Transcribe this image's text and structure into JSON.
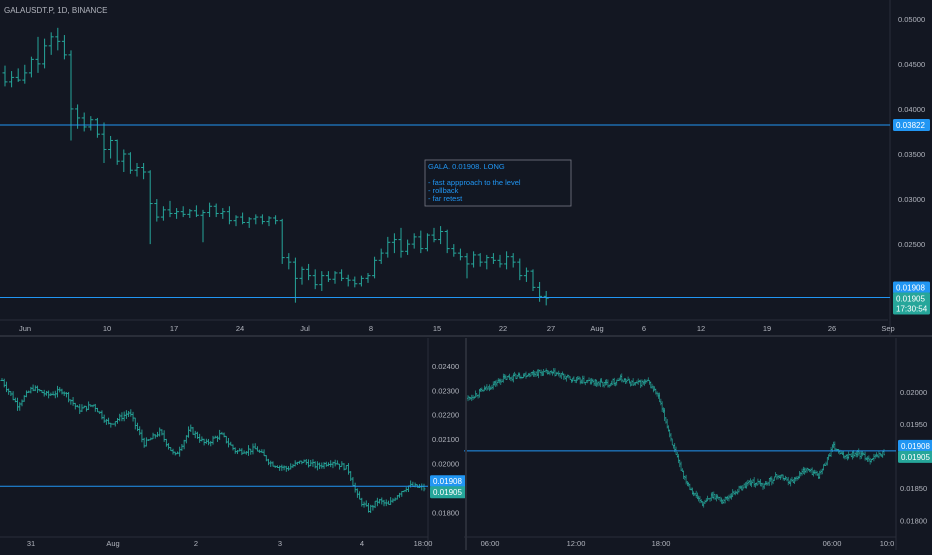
{
  "colors": {
    "background": "#131722",
    "candle": "#26a69a",
    "level_line": "#2196f3",
    "label_text": "#b2b5be",
    "divider": "#2a2e39",
    "price_tag_level": "#2196f3",
    "price_tag_last": "#26a69a",
    "annotation_text": "#2196f3",
    "annotation_border": "#787b86"
  },
  "header": {
    "symbol_line": "GALAUSDT.P, 1D, BINANCE"
  },
  "annotation": {
    "lines": [
      "GALA. 0.01908. LONG",
      "",
      "- fast appproach to the level",
      "- rollback",
      "- far retest"
    ]
  },
  "chart_data": [
    {
      "type": "bar",
      "panel": "main",
      "interval": "1D",
      "x_tick_labels": [
        "Jun",
        "10",
        "17",
        "24",
        "Jul",
        "8",
        "15",
        "22",
        "27",
        "Aug",
        "6",
        "12",
        "19",
        "26",
        "Sep"
      ],
      "y_tick_labels": [
        "0.05000",
        "0.04500",
        "0.04000",
        "0.03500",
        "0.03000",
        "0.02500"
      ],
      "ylim": [
        0.0168,
        0.0512
      ],
      "horizontal_levels": [
        0.03822,
        0.01908
      ],
      "price_tags": [
        {
          "value": "0.03822",
          "kind": "level"
        },
        {
          "value": "0.01908",
          "kind": "level"
        },
        {
          "value": "0.01905",
          "kind": "last"
        },
        {
          "value": "17:30:54",
          "kind": "countdown"
        }
      ],
      "series": [
        {
          "values": [
            {
              "o": 0.044,
              "h": 0.0448,
              "l": 0.0425,
              "c": 0.043
            },
            {
              "o": 0.043,
              "h": 0.0442,
              "l": 0.0424,
              "c": 0.0435
            },
            {
              "o": 0.0435,
              "h": 0.0445,
              "l": 0.043,
              "c": 0.0432
            },
            {
              "o": 0.0432,
              "h": 0.0449,
              "l": 0.0428,
              "c": 0.044
            },
            {
              "o": 0.044,
              "h": 0.0458,
              "l": 0.0435,
              "c": 0.0455
            },
            {
              "o": 0.0455,
              "h": 0.048,
              "l": 0.044,
              "c": 0.045
            },
            {
              "o": 0.045,
              "h": 0.0478,
              "l": 0.0445,
              "c": 0.047
            },
            {
              "o": 0.047,
              "h": 0.0485,
              "l": 0.046,
              "c": 0.048
            },
            {
              "o": 0.048,
              "h": 0.049,
              "l": 0.0465,
              "c": 0.0475
            },
            {
              "o": 0.0475,
              "h": 0.0482,
              "l": 0.0455,
              "c": 0.046
            },
            {
              "o": 0.046,
              "h": 0.0465,
              "l": 0.0365,
              "c": 0.04
            },
            {
              "o": 0.04,
              "h": 0.0405,
              "l": 0.0378,
              "c": 0.039
            },
            {
              "o": 0.039,
              "h": 0.0396,
              "l": 0.0375,
              "c": 0.038
            },
            {
              "o": 0.038,
              "h": 0.0392,
              "l": 0.0376,
              "c": 0.0388
            },
            {
              "o": 0.0388,
              "h": 0.039,
              "l": 0.0368,
              "c": 0.0372
            },
            {
              "o": 0.0372,
              "h": 0.0385,
              "l": 0.034,
              "c": 0.0355
            },
            {
              "o": 0.0355,
              "h": 0.037,
              "l": 0.0345,
              "c": 0.0365
            },
            {
              "o": 0.0365,
              "h": 0.0366,
              "l": 0.0338,
              "c": 0.0342
            },
            {
              "o": 0.0342,
              "h": 0.0355,
              "l": 0.033,
              "c": 0.035
            },
            {
              "o": 0.035,
              "h": 0.0352,
              "l": 0.0328,
              "c": 0.0332
            },
            {
              "o": 0.0332,
              "h": 0.034,
              "l": 0.0325,
              "c": 0.0335
            },
            {
              "o": 0.0335,
              "h": 0.034,
              "l": 0.0322,
              "c": 0.033
            },
            {
              "o": 0.033,
              "h": 0.0332,
              "l": 0.025,
              "c": 0.0295
            },
            {
              "o": 0.0295,
              "h": 0.03,
              "l": 0.0275,
              "c": 0.028
            },
            {
              "o": 0.028,
              "h": 0.0292,
              "l": 0.0276,
              "c": 0.0288
            },
            {
              "o": 0.0288,
              "h": 0.0298,
              "l": 0.028,
              "c": 0.0284
            },
            {
              "o": 0.0284,
              "h": 0.029,
              "l": 0.0278,
              "c": 0.0286
            },
            {
              "o": 0.0286,
              "h": 0.0292,
              "l": 0.028,
              "c": 0.0283
            },
            {
              "o": 0.0283,
              "h": 0.0289,
              "l": 0.0279,
              "c": 0.0287
            },
            {
              "o": 0.0287,
              "h": 0.0293,
              "l": 0.028,
              "c": 0.0282
            },
            {
              "o": 0.0282,
              "h": 0.0288,
              "l": 0.0252,
              "c": 0.0285
            },
            {
              "o": 0.0285,
              "h": 0.0296,
              "l": 0.028,
              "c": 0.0292
            },
            {
              "o": 0.0292,
              "h": 0.0295,
              "l": 0.028,
              "c": 0.0284
            },
            {
              "o": 0.0284,
              "h": 0.029,
              "l": 0.0278,
              "c": 0.0286
            },
            {
              "o": 0.0286,
              "h": 0.0292,
              "l": 0.0272,
              "c": 0.0276
            },
            {
              "o": 0.0276,
              "h": 0.0282,
              "l": 0.027,
              "c": 0.028
            },
            {
              "o": 0.028,
              "h": 0.0285,
              "l": 0.0272,
              "c": 0.0274
            },
            {
              "o": 0.0274,
              "h": 0.028,
              "l": 0.0268,
              "c": 0.0278
            },
            {
              "o": 0.0278,
              "h": 0.0283,
              "l": 0.0272,
              "c": 0.028
            },
            {
              "o": 0.028,
              "h": 0.0283,
              "l": 0.0272,
              "c": 0.0275
            },
            {
              "o": 0.0275,
              "h": 0.0281,
              "l": 0.027,
              "c": 0.0279
            },
            {
              "o": 0.0279,
              "h": 0.0282,
              "l": 0.0272,
              "c": 0.0276
            },
            {
              "o": 0.0276,
              "h": 0.0278,
              "l": 0.0228,
              "c": 0.0235
            },
            {
              "o": 0.0235,
              "h": 0.024,
              "l": 0.0222,
              "c": 0.023
            },
            {
              "o": 0.023,
              "h": 0.0235,
              "l": 0.0185,
              "c": 0.0212
            },
            {
              "o": 0.0212,
              "h": 0.0225,
              "l": 0.0205,
              "c": 0.0222
            },
            {
              "o": 0.0222,
              "h": 0.0228,
              "l": 0.021,
              "c": 0.0215
            },
            {
              "o": 0.0215,
              "h": 0.0222,
              "l": 0.02,
              "c": 0.0205
            },
            {
              "o": 0.0205,
              "h": 0.022,
              "l": 0.0198,
              "c": 0.0215
            },
            {
              "o": 0.0215,
              "h": 0.022,
              "l": 0.0208,
              "c": 0.0211
            },
            {
              "o": 0.0211,
              "h": 0.022,
              "l": 0.0206,
              "c": 0.0218
            },
            {
              "o": 0.0218,
              "h": 0.0222,
              "l": 0.0209,
              "c": 0.0212
            },
            {
              "o": 0.0212,
              "h": 0.0216,
              "l": 0.0203,
              "c": 0.021
            },
            {
              "o": 0.021,
              "h": 0.0214,
              "l": 0.0202,
              "c": 0.0206
            },
            {
              "o": 0.0206,
              "h": 0.0215,
              "l": 0.0203,
              "c": 0.0212
            },
            {
              "o": 0.0212,
              "h": 0.0218,
              "l": 0.0207,
              "c": 0.0215
            },
            {
              "o": 0.0215,
              "h": 0.0236,
              "l": 0.0212,
              "c": 0.0232
            },
            {
              "o": 0.0232,
              "h": 0.0245,
              "l": 0.0228,
              "c": 0.024
            },
            {
              "o": 0.024,
              "h": 0.0258,
              "l": 0.0235,
              "c": 0.0252
            },
            {
              "o": 0.0252,
              "h": 0.0262,
              "l": 0.024,
              "c": 0.0255
            },
            {
              "o": 0.0255,
              "h": 0.0268,
              "l": 0.0235,
              "c": 0.0242
            },
            {
              "o": 0.0242,
              "h": 0.0255,
              "l": 0.0238,
              "c": 0.025
            },
            {
              "o": 0.025,
              "h": 0.0262,
              "l": 0.0245,
              "c": 0.0258
            },
            {
              "o": 0.0258,
              "h": 0.0265,
              "l": 0.024,
              "c": 0.0245
            },
            {
              "o": 0.0245,
              "h": 0.0262,
              "l": 0.0242,
              "c": 0.026
            },
            {
              "o": 0.026,
              "h": 0.0268,
              "l": 0.0252,
              "c": 0.0255
            },
            {
              "o": 0.0255,
              "h": 0.027,
              "l": 0.025,
              "c": 0.0264
            },
            {
              "o": 0.0264,
              "h": 0.0266,
              "l": 0.024,
              "c": 0.0245
            },
            {
              "o": 0.0245,
              "h": 0.025,
              "l": 0.0236,
              "c": 0.024
            },
            {
              "o": 0.024,
              "h": 0.0245,
              "l": 0.0232,
              "c": 0.0236
            },
            {
              "o": 0.0236,
              "h": 0.024,
              "l": 0.0212,
              "c": 0.0228
            },
            {
              "o": 0.0228,
              "h": 0.0242,
              "l": 0.0224,
              "c": 0.0238
            },
            {
              "o": 0.0238,
              "h": 0.024,
              "l": 0.0225,
              "c": 0.023
            },
            {
              "o": 0.023,
              "h": 0.0238,
              "l": 0.0222,
              "c": 0.0235
            },
            {
              "o": 0.0235,
              "h": 0.024,
              "l": 0.0228,
              "c": 0.0232
            },
            {
              "o": 0.0232,
              "h": 0.0238,
              "l": 0.0224,
              "c": 0.0228
            },
            {
              "o": 0.0228,
              "h": 0.0242,
              "l": 0.0222,
              "c": 0.0236
            },
            {
              "o": 0.0236,
              "h": 0.024,
              "l": 0.0224,
              "c": 0.023
            },
            {
              "o": 0.023,
              "h": 0.0234,
              "l": 0.021,
              "c": 0.0215
            },
            {
              "o": 0.0215,
              "h": 0.0224,
              "l": 0.0208,
              "c": 0.022
            },
            {
              "o": 0.022,
              "h": 0.0222,
              "l": 0.0198,
              "c": 0.0202
            },
            {
              "o": 0.0202,
              "h": 0.0208,
              "l": 0.0186,
              "c": 0.0192
            },
            {
              "o": 0.0192,
              "h": 0.0198,
              "l": 0.0182,
              "c": 0.019
            }
          ]
        }
      ]
    },
    {
      "type": "bar",
      "panel": "bottom-left",
      "x_tick_labels": [
        "31",
        "Aug",
        "2",
        "3",
        "4",
        "18:00"
      ],
      "y_tick_labels": [
        "0.02400",
        "0.02300",
        "0.02200",
        "0.02100",
        "0.02000",
        "0.01800"
      ],
      "ylim": [
        0.0177,
        0.0244
      ],
      "horizontal_levels": [
        0.01908
      ],
      "price_tags": [
        {
          "value": "0.01908",
          "kind": "level"
        },
        {
          "value": "0.01905",
          "kind": "last"
        }
      ],
      "path": [
        [
          0,
          0.0234
        ],
        [
          6,
          0.0224
        ],
        [
          12,
          0.0231
        ],
        [
          18,
          0.0228
        ],
        [
          24,
          0.023
        ],
        [
          30,
          0.0222
        ],
        [
          36,
          0.0224
        ],
        [
          42,
          0.0216
        ],
        [
          50,
          0.0221
        ],
        [
          56,
          0.0208
        ],
        [
          62,
          0.0213
        ],
        [
          68,
          0.0203
        ],
        [
          74,
          0.0214
        ],
        [
          80,
          0.0208
        ],
        [
          86,
          0.0212
        ],
        [
          92,
          0.0205
        ],
        [
          100,
          0.0206
        ],
        [
          106,
          0.02
        ],
        [
          112,
          0.0198
        ],
        [
          118,
          0.0201
        ],
        [
          124,
          0.0199
        ],
        [
          130,
          0.0201
        ],
        [
          136,
          0.0198
        ],
        [
          140,
          0.0186
        ],
        [
          144,
          0.0181
        ],
        [
          148,
          0.0185
        ],
        [
          152,
          0.0183
        ],
        [
          156,
          0.0188
        ],
        [
          160,
          0.0191
        ],
        [
          166,
          0.019
        ]
      ],
      "x_range": [
        0,
        166
      ]
    },
    {
      "type": "bar",
      "panel": "bottom-right",
      "x_tick_labels": [
        "06:00",
        "12:00",
        "18:00",
        "06:00",
        "10:0"
      ],
      "y_tick_labels": [
        "0.02000",
        "0.01950",
        "0.01850",
        "0.01800"
      ],
      "ylim": [
        0.01785,
        0.02065
      ],
      "horizontal_levels": [
        0.01908
      ],
      "price_tags": [
        {
          "value": "0.01908",
          "kind": "level"
        },
        {
          "value": "0.01905",
          "kind": "last"
        }
      ],
      "path": [
        [
          0,
          0.0199
        ],
        [
          8,
          0.02005
        ],
        [
          15,
          0.0202
        ],
        [
          22,
          0.02025
        ],
        [
          30,
          0.0203
        ],
        [
          38,
          0.02028
        ],
        [
          46,
          0.02018
        ],
        [
          54,
          0.02015
        ],
        [
          60,
          0.02012
        ],
        [
          66,
          0.0202
        ],
        [
          72,
          0.02012
        ],
        [
          78,
          0.02015
        ],
        [
          82,
          0.01995
        ],
        [
          86,
          0.0195
        ],
        [
          90,
          0.019
        ],
        [
          94,
          0.01865
        ],
        [
          98,
          0.0184
        ],
        [
          102,
          0.01825
        ],
        [
          106,
          0.0184
        ],
        [
          110,
          0.0183
        ],
        [
          116,
          0.01845
        ],
        [
          122,
          0.0186
        ],
        [
          128,
          0.01855
        ],
        [
          134,
          0.0187
        ],
        [
          140,
          0.0186
        ],
        [
          146,
          0.0188
        ],
        [
          152,
          0.0187
        ],
        [
          158,
          0.01915
        ],
        [
          162,
          0.019
        ],
        [
          168,
          0.01905
        ],
        [
          174,
          0.01895
        ],
        [
          180,
          0.01905
        ]
      ],
      "x_range": [
        0,
        180
      ]
    }
  ]
}
